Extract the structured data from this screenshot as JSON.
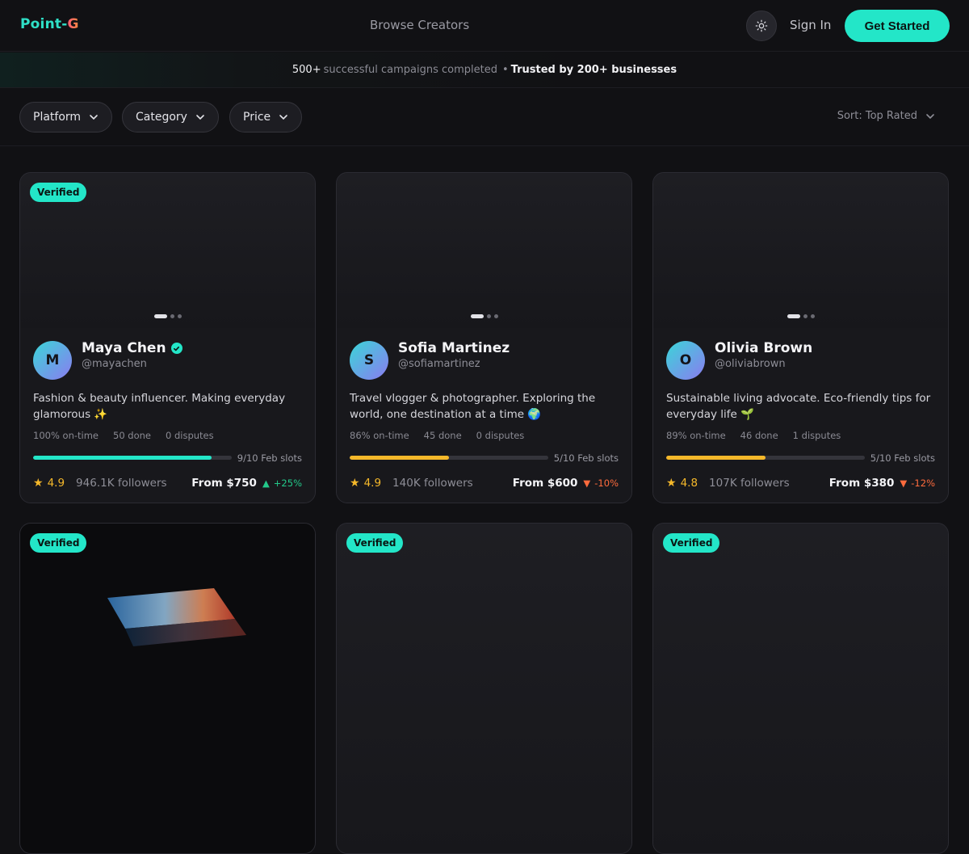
{
  "header": {
    "logo_main": "Point-",
    "logo_accent": "G",
    "nav_browse": "Browse Creators",
    "theme_icon": "sun-icon",
    "sign_in": "Sign In",
    "get_started": "Get Started"
  },
  "banner": {
    "campaigns_count": "500+",
    "campaigns_text": "successful campaigns completed",
    "separator": "•",
    "trusted_text": "Trusted by 200+ businesses"
  },
  "filters": {
    "platform": "Platform",
    "category": "Category",
    "price": "Price",
    "sort": "Sort: Top Rated"
  },
  "creators": [
    {
      "verified_label": "Verified",
      "show_verified": true,
      "initial": "M",
      "name": "Maya Chen",
      "name_verified": true,
      "handle": "@mayachen",
      "bio": "Fashion & beauty influencer. Making everyday glamorous ✨",
      "on_time": "100% on-time",
      "done": "50 done",
      "disputes": "0 disputes",
      "slots_fill": 0.9,
      "slots_color": "#23e6c8",
      "slots": "9/10 Feb slots",
      "rating": "4.9",
      "followers": "946.1K followers",
      "price": "From $750",
      "delta_icon": "▲",
      "delta": "+25%",
      "delta_color": "#23c98a"
    },
    {
      "verified_label": "",
      "show_verified": false,
      "initial": "S",
      "name": "Sofia Martinez",
      "name_verified": false,
      "handle": "@sofiamartinez",
      "bio": "Travel vlogger & photographer. Exploring the world, one destination at a time 🌍",
      "on_time": "86% on-time",
      "done": "45 done",
      "disputes": "0 disputes",
      "slots_fill": 0.5,
      "slots_color": "#f5b82a",
      "slots": "5/10 Feb slots",
      "rating": "4.9",
      "followers": "140K followers",
      "price": "From $600",
      "delta_icon": "▼",
      "delta": "-10%",
      "delta_color": "#ff6b3d"
    },
    {
      "verified_label": "",
      "show_verified": false,
      "initial": "O",
      "name": "Olivia Brown",
      "name_verified": false,
      "handle": "@oliviabrown",
      "bio": "Sustainable living advocate. Eco-friendly tips for everyday life 🌱",
      "on_time": "89% on-time",
      "done": "46 done",
      "disputes": "1 disputes",
      "slots_fill": 0.5,
      "slots_color": "#f5b82a",
      "slots": "5/10 Feb slots",
      "rating": "4.8",
      "followers": "107K followers",
      "price": "From $380",
      "delta_icon": "▼",
      "delta": "-12%",
      "delta_color": "#ff6b3d"
    }
  ],
  "row2": [
    {
      "verified_label": "Verified"
    },
    {
      "verified_label": "Verified"
    },
    {
      "verified_label": "Verified"
    }
  ]
}
